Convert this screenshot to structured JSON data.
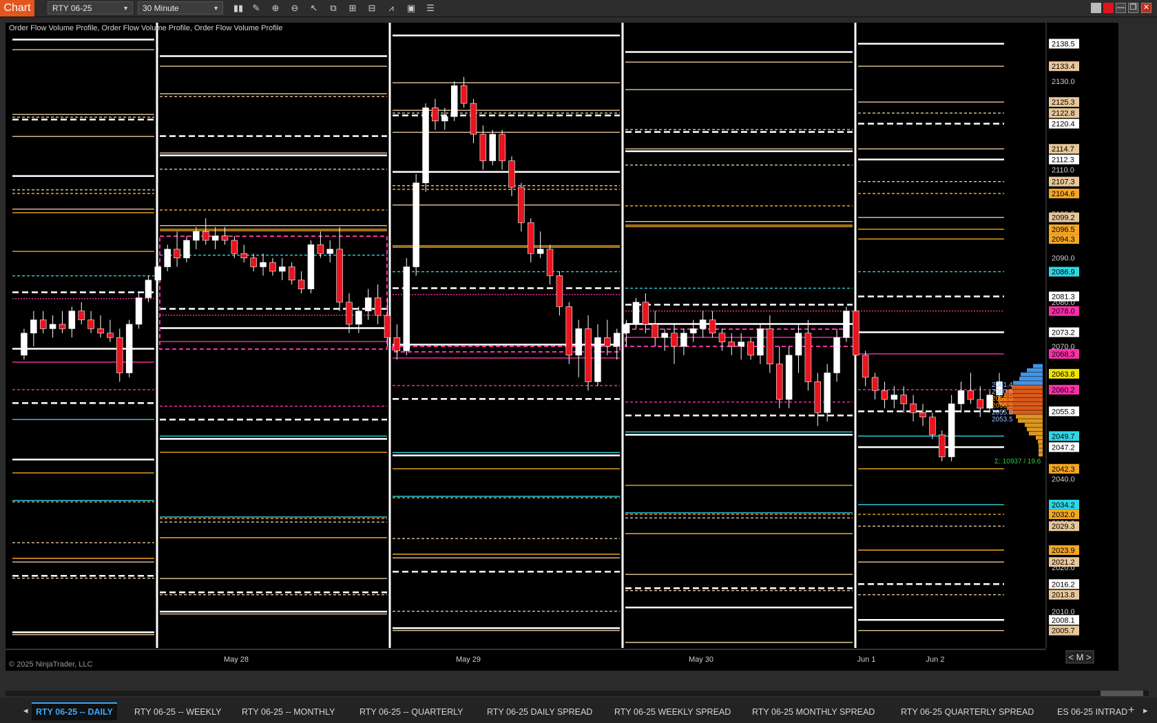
{
  "toolbar": {
    "chart_label": "Chart",
    "instrument": "RTY 06-25",
    "timeframe": "30 Minute"
  },
  "indicator_label": "Order Flow Volume Profile, Order Flow Volume Profile, Order Flow Volume Profile",
  "copyright": "© 2025 NinjaTrader, LLC",
  "colors": {
    "background": "#000000",
    "up_candle": "#ffffff",
    "down_candle": "#e8141e",
    "poc": "#ff2fa8",
    "value_area": "#2fd7e6",
    "level_orange": "#f5a623",
    "level_tan": "#e8c79a",
    "level_white": "#ffffff"
  },
  "price_axis": {
    "ticks": [
      "2130.0",
      "2120.0",
      "2110.0",
      "2100.0",
      "2090.0",
      "2080.0",
      "2070.0",
      "2060.0",
      "2050.0",
      "2040.0",
      "2030.0",
      "2020.0",
      "2010.0"
    ],
    "markers": [
      {
        "label": "2138.5",
        "color": "#ffffff",
        "text": "#000000"
      },
      {
        "label": "2133.4",
        "color": "#e8c79a",
        "text": "#000000"
      },
      {
        "label": "2125.3",
        "color": "#e8c79a",
        "text": "#000000"
      },
      {
        "label": "2122.8",
        "color": "#e8c79a",
        "text": "#000000"
      },
      {
        "label": "2120.4",
        "color": "#ffffff",
        "text": "#000000"
      },
      {
        "label": "2114.7",
        "color": "#e8c79a",
        "text": "#000000"
      },
      {
        "label": "2112.3",
        "color": "#ffffff",
        "text": "#000000"
      },
      {
        "label": "2107.3",
        "color": "#e8c79a",
        "text": "#000000"
      },
      {
        "label": "2104.6",
        "color": "#f5a623",
        "text": "#000000"
      },
      {
        "label": "2099.2",
        "color": "#e8c79a",
        "text": "#000000"
      },
      {
        "label": "2096.5",
        "color": "#f5a623",
        "text": "#000000"
      },
      {
        "label": "2094.3",
        "color": "#f5a623",
        "text": "#000000"
      },
      {
        "label": "2086.9",
        "color": "#2fd7e6",
        "text": "#000000"
      },
      {
        "label": "2081.3",
        "color": "#ffffff",
        "text": "#000000"
      },
      {
        "label": "2078.0",
        "color": "#ff2fa8",
        "text": "#000000"
      },
      {
        "label": "2073.2",
        "color": "#ffffff",
        "text": "#000000"
      },
      {
        "label": "2068.3",
        "color": "#ff2fa8",
        "text": "#000000"
      },
      {
        "label": "2063.8",
        "color": "#f2e500",
        "text": "#000000"
      },
      {
        "label": "2060.2",
        "color": "#ff2fa8",
        "text": "#000000"
      },
      {
        "label": "2055.3",
        "color": "#ffffff",
        "text": "#000000"
      },
      {
        "label": "2049.7",
        "color": "#2fd7e6",
        "text": "#000000"
      },
      {
        "label": "2047.2",
        "color": "#ffffff",
        "text": "#000000"
      },
      {
        "label": "2042.3",
        "color": "#f5a623",
        "text": "#000000"
      },
      {
        "label": "2034.2",
        "color": "#2fd7e6",
        "text": "#000000"
      },
      {
        "label": "2032.0",
        "color": "#f5a623",
        "text": "#000000"
      },
      {
        "label": "2029.3",
        "color": "#e8c79a",
        "text": "#000000"
      },
      {
        "label": "2023.9",
        "color": "#f5a623",
        "text": "#000000"
      },
      {
        "label": "2021.2",
        "color": "#e8c79a",
        "text": "#000000"
      },
      {
        "label": "2016.2",
        "color": "#ffffff",
        "text": "#000000"
      },
      {
        "label": "2013.8",
        "color": "#e8c79a",
        "text": "#000000"
      },
      {
        "label": "2008.1",
        "color": "#ffffff",
        "text": "#000000"
      },
      {
        "label": "2005.7",
        "color": "#e8c79a",
        "text": "#000000"
      }
    ]
  },
  "time_axis": [
    "May 28",
    "May 29",
    "May 30",
    "Jun 1",
    "Jun 2"
  ],
  "profile_labels": [
    "2061.4",
    "2060.8",
    "2059.0",
    "2056.5",
    "2055.0",
    "2053.5"
  ],
  "profile_total": "Σ: 10937 / 19.6",
  "scale_mode": "M",
  "tabs": [
    {
      "label": "RTY 06-25 -- DAILY",
      "active": true
    },
    {
      "label": "RTY 06-25 -- WEEKLY",
      "active": false
    },
    {
      "label": "RTY 06-25 -- MONTHLY",
      "active": false
    },
    {
      "label": "RTY 06-25 -- QUARTERLY",
      "active": false
    },
    {
      "label": "RTY 06-25 DAILY SPREAD",
      "active": false
    },
    {
      "label": "RTY 06-25 WEEKLY SPREAD",
      "active": false
    },
    {
      "label": "RTY 06-25 MONTHLY SPREAD",
      "active": false
    },
    {
      "label": "RTY 06-25 QUARTERLY SPREAD",
      "active": false
    },
    {
      "label": "ES 06-25 INTRAD",
      "active": false
    }
  ],
  "chart_data": {
    "type": "candlestick",
    "ylim": [
      2003,
      2142
    ],
    "x_labels": [
      "May 28",
      "May 29",
      "May 30",
      "Jun 1",
      "Jun 2"
    ],
    "candles": [
      [
        2068,
        2074,
        2067,
        2073
      ],
      [
        2073,
        2078,
        2070,
        2076
      ],
      [
        2076,
        2078,
        2073,
        2074
      ],
      [
        2074,
        2077,
        2072,
        2075
      ],
      [
        2075,
        2078,
        2073,
        2074
      ],
      [
        2074,
        2079,
        2072,
        2078
      ],
      [
        2078,
        2080,
        2075,
        2076
      ],
      [
        2076,
        2078,
        2073,
        2074
      ],
      [
        2074,
        2077,
        2072,
        2073
      ],
      [
        2073,
        2076,
        2071,
        2072
      ],
      [
        2072,
        2074,
        2062,
        2064
      ],
      [
        2064,
        2076,
        2063,
        2075
      ],
      [
        2075,
        2082,
        2074,
        2081
      ],
      [
        2081,
        2086,
        2080,
        2085
      ],
      [
        2085,
        2089,
        2084,
        2088
      ],
      [
        2088,
        2093,
        2087,
        2092
      ],
      [
        2092,
        2096,
        2088,
        2090
      ],
      [
        2090,
        2095,
        2089,
        2094
      ],
      [
        2094,
        2097,
        2092,
        2096
      ],
      [
        2096,
        2099,
        2093,
        2094
      ],
      [
        2094,
        2097,
        2092,
        2095
      ],
      [
        2095,
        2097,
        2093,
        2094
      ],
      [
        2094,
        2095,
        2090,
        2091
      ],
      [
        2091,
        2093,
        2089,
        2090
      ],
      [
        2090,
        2091,
        2087,
        2088
      ],
      [
        2088,
        2091,
        2086,
        2089
      ],
      [
        2089,
        2090,
        2086,
        2087
      ],
      [
        2087,
        2090,
        2085,
        2088
      ],
      [
        2088,
        2089,
        2084,
        2085
      ],
      [
        2085,
        2087,
        2082,
        2083
      ],
      [
        2083,
        2094,
        2082,
        2093
      ],
      [
        2093,
        2096,
        2090,
        2091
      ],
      [
        2091,
        2094,
        2089,
        2092
      ],
      [
        2092,
        2097,
        2078,
        2080
      ],
      [
        2080,
        2082,
        2073,
        2075
      ],
      [
        2075,
        2079,
        2073,
        2078
      ],
      [
        2078,
        2083,
        2076,
        2081
      ],
      [
        2081,
        2084,
        2075,
        2077
      ],
      [
        2077,
        2081,
        2070,
        2072
      ],
      [
        2072,
        2075,
        2067,
        2069
      ],
      [
        2069,
        2090,
        2068,
        2088
      ],
      [
        2088,
        2109,
        2086,
        2107
      ],
      [
        2107,
        2125,
        2105,
        2124
      ],
      [
        2124,
        2126,
        2119,
        2121
      ],
      [
        2121,
        2124,
        2119,
        2122
      ],
      [
        2122,
        2130,
        2121,
        2129
      ],
      [
        2129,
        2131,
        2124,
        2125
      ],
      [
        2125,
        2126,
        2116,
        2118
      ],
      [
        2118,
        2120,
        2110,
        2112
      ],
      [
        2112,
        2119,
        2111,
        2118
      ],
      [
        2118,
        2119,
        2110,
        2112
      ],
      [
        2112,
        2113,
        2104,
        2106
      ],
      [
        2106,
        2107,
        2096,
        2098
      ],
      [
        2098,
        2099,
        2089,
        2091
      ],
      [
        2091,
        2096,
        2090,
        2092
      ],
      [
        2092,
        2093,
        2084,
        2086
      ],
      [
        2086,
        2087,
        2077,
        2079
      ],
      [
        2079,
        2080,
        2066,
        2068
      ],
      [
        2068,
        2076,
        2063,
        2074
      ],
      [
        2074,
        2077,
        2060,
        2062
      ],
      [
        2062,
        2075,
        2061,
        2072
      ],
      [
        2072,
        2076,
        2068,
        2070
      ],
      [
        2070,
        2074,
        2067,
        2073
      ],
      [
        2073,
        2076,
        2070,
        2075
      ],
      [
        2075,
        2081,
        2074,
        2080
      ],
      [
        2080,
        2082,
        2073,
        2075
      ],
      [
        2075,
        2078,
        2070,
        2072
      ],
      [
        2072,
        2074,
        2069,
        2073
      ],
      [
        2073,
        2075,
        2066,
        2070
      ],
      [
        2070,
        2074,
        2068,
        2073
      ],
      [
        2073,
        2076,
        2071,
        2074
      ],
      [
        2074,
        2078,
        2072,
        2076
      ],
      [
        2076,
        2078,
        2072,
        2073
      ],
      [
        2073,
        2074,
        2069,
        2071
      ],
      [
        2071,
        2073,
        2068,
        2070
      ],
      [
        2070,
        2073,
        2067,
        2071
      ],
      [
        2071,
        2072,
        2067,
        2068
      ],
      [
        2068,
        2075,
        2066,
        2074
      ],
      [
        2074,
        2077,
        2064,
        2066
      ],
      [
        2066,
        2070,
        2056,
        2058
      ],
      [
        2058,
        2070,
        2056,
        2068
      ],
      [
        2068,
        2075,
        2064,
        2073
      ],
      [
        2073,
        2076,
        2060,
        2062
      ],
      [
        2062,
        2064,
        2052,
        2055
      ],
      [
        2055,
        2066,
        2053,
        2064
      ],
      [
        2064,
        2074,
        2062,
        2072
      ],
      [
        2072,
        2079,
        2071,
        2078
      ],
      [
        2078,
        2080,
        2066,
        2068
      ],
      [
        2068,
        2069,
        2061,
        2063
      ],
      [
        2063,
        2064,
        2058,
        2060
      ],
      [
        2060,
        2062,
        2056,
        2058
      ],
      [
        2058,
        2061,
        2056,
        2059
      ],
      [
        2059,
        2061,
        2055,
        2057
      ],
      [
        2057,
        2059,
        2053,
        2055
      ],
      [
        2055,
        2057,
        2052,
        2054
      ],
      [
        2054,
        2055,
        2049,
        2050
      ],
      [
        2050,
        2051,
        2044,
        2045
      ],
      [
        2045,
        2059,
        2044,
        2057
      ],
      [
        2057,
        2062,
        2055,
        2060
      ],
      [
        2060,
        2064,
        2057,
        2058
      ],
      [
        2058,
        2061,
        2054,
        2056
      ],
      [
        2056,
        2060,
        2055,
        2059
      ],
      [
        2059,
        2064,
        2057,
        2062
      ]
    ],
    "session_breaks": [
      2097.5,
      2070.0,
      2120.4,
      2134.0,
      2063.0
    ],
    "levels": [
      {
        "price": 2133.4,
        "color": "#e8c79a",
        "style": "solid"
      },
      {
        "price": 2125.3,
        "color": "#e8c79a",
        "style": "solid"
      },
      {
        "price": 2122.8,
        "color": "#e8c79a",
        "style": "dashed"
      },
      {
        "price": 2120.4,
        "color": "#ffffff",
        "style": "bigdash"
      },
      {
        "price": 2114.7,
        "color": "#e8c79a",
        "style": "solid"
      },
      {
        "price": 2112.3,
        "color": "#ffffff",
        "style": "solid"
      },
      {
        "price": 2107.3,
        "color": "#e8c79a",
        "style": "dashed"
      },
      {
        "price": 2104.6,
        "color": "#f5a623",
        "style": "dashed"
      },
      {
        "price": 2099.2,
        "color": "#e8c79a",
        "style": "solid"
      },
      {
        "price": 2096.5,
        "color": "#f5a623",
        "style": "solid"
      },
      {
        "price": 2094.3,
        "color": "#f5a623",
        "style": "solid"
      },
      {
        "price": 2086.9,
        "color": "#2fd7e6",
        "style": "dashed"
      },
      {
        "price": 2081.3,
        "color": "#ffffff",
        "style": "bigdash"
      },
      {
        "price": 2078.0,
        "color": "#ff2fa8",
        "style": "dotted"
      },
      {
        "price": 2073.2,
        "color": "#ffffff",
        "style": "solid"
      },
      {
        "price": 2068.3,
        "color": "#ff2fa8",
        "style": "solid"
      },
      {
        "price": 2060.2,
        "color": "#ff2fa8",
        "style": "dashed"
      },
      {
        "price": 2055.3,
        "color": "#ffffff",
        "style": "bigdash"
      },
      {
        "price": 2049.7,
        "color": "#2fd7e6",
        "style": "solid"
      },
      {
        "price": 2047.2,
        "color": "#ffffff",
        "style": "solid"
      },
      {
        "price": 2042.3,
        "color": "#f5a623",
        "style": "solid"
      },
      {
        "price": 2034.2,
        "color": "#2fd7e6",
        "style": "solid"
      },
      {
        "price": 2032.0,
        "color": "#f5a623",
        "style": "dashed"
      },
      {
        "price": 2029.3,
        "color": "#e8c79a",
        "style": "dashed"
      },
      {
        "price": 2023.9,
        "color": "#f5a623",
        "style": "solid"
      },
      {
        "price": 2021.2,
        "color": "#e8c79a",
        "style": "solid"
      },
      {
        "price": 2016.2,
        "color": "#ffffff",
        "style": "bigdash"
      },
      {
        "price": 2013.8,
        "color": "#e8c79a",
        "style": "dashed"
      },
      {
        "price": 2008.1,
        "color": "#ffffff",
        "style": "solid"
      },
      {
        "price": 2005.7,
        "color": "#e8c79a",
        "style": "solid"
      },
      {
        "price": 2138.5,
        "color": "#ffffff",
        "style": "solid"
      }
    ]
  }
}
